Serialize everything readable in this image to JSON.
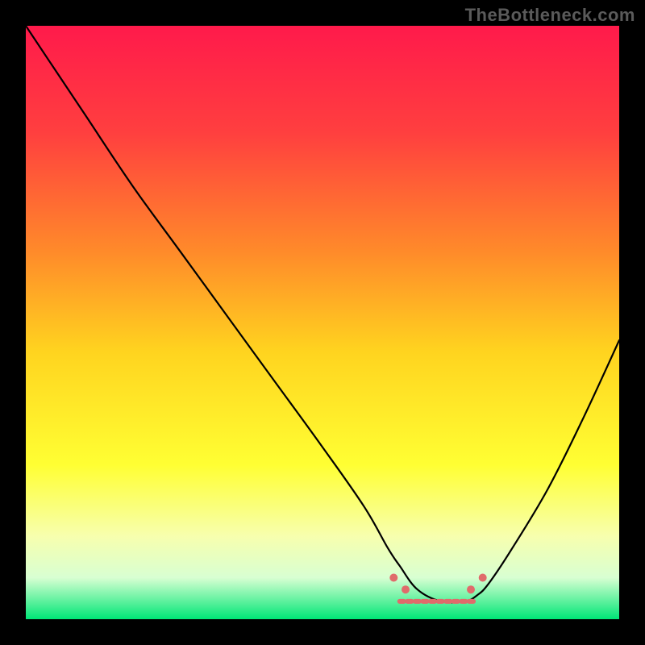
{
  "watermark": "TheBottleneck.com",
  "gradient": {
    "stops": [
      {
        "offset": 0.0,
        "color": "#ff1a4b"
      },
      {
        "offset": 0.18,
        "color": "#ff3f3f"
      },
      {
        "offset": 0.38,
        "color": "#ff8a2a"
      },
      {
        "offset": 0.55,
        "color": "#ffd41f"
      },
      {
        "offset": 0.74,
        "color": "#ffff33"
      },
      {
        "offset": 0.86,
        "color": "#f7ffae"
      },
      {
        "offset": 0.93,
        "color": "#d8ffd2"
      },
      {
        "offset": 1.0,
        "color": "#00e676"
      }
    ]
  },
  "chart_data": {
    "type": "line",
    "title": "",
    "xlabel": "",
    "ylabel": "",
    "xlim": [
      0,
      100
    ],
    "ylim": [
      0,
      100
    ],
    "series": [
      {
        "name": "bottleneck-curve",
        "x": [
          0,
          4,
          10,
          18,
          26,
          34,
          42,
          50,
          57,
          61,
          63,
          66,
          70,
          74,
          76,
          78,
          82,
          88,
          94,
          100
        ],
        "values": [
          100,
          94,
          85,
          73,
          62,
          51,
          40,
          29,
          19,
          12,
          9,
          5,
          3,
          3,
          4,
          6,
          12,
          22,
          34,
          47
        ]
      }
    ],
    "optimal_band": {
      "x_start": 63,
      "x_end": 76,
      "y_level": 3
    },
    "optimal_markers": [
      {
        "x": 62,
        "y": 7
      },
      {
        "x": 64,
        "y": 5
      },
      {
        "x": 75,
        "y": 5
      },
      {
        "x": 77,
        "y": 7
      }
    ]
  }
}
